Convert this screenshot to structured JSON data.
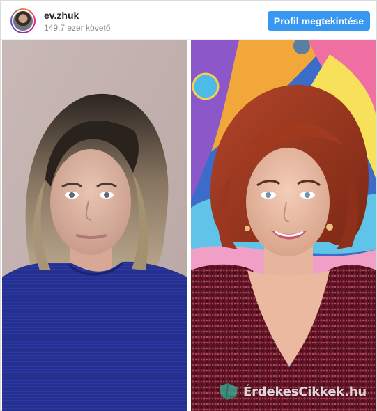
{
  "header": {
    "username": "ev.zhuk",
    "followers": "149.7 ezer követő",
    "profile_button_label": "Profil megtekintése"
  },
  "post": {
    "left_photo": "before-portrait",
    "right_photo": "after-portrait"
  },
  "watermark": {
    "text": "ÉrdekesCikkek.hu",
    "icon": "site-logo-icon"
  },
  "colors": {
    "button": "#3897f0",
    "before_sweater": "#27308f",
    "after_dress": "#6e1a2c"
  }
}
